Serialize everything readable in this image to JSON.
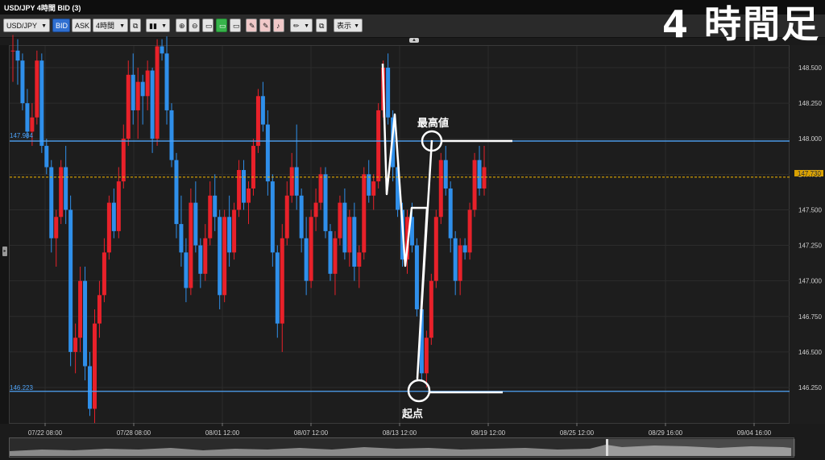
{
  "window": {
    "title": "USD/JPY 4時間 BID (3)"
  },
  "overlay_title": "4 時間足",
  "toolbar": {
    "symbol": "USD/JPY",
    "bid": "BID",
    "ask": "ASK",
    "timeframe": "4時間",
    "display": "表示"
  },
  "colors": {
    "up": "#e8212a",
    "down": "#2f8fea",
    "hline": "#4fa3f7",
    "current": "#f5b800",
    "annotation": "#ffffff"
  },
  "y_ticks": [
    "148.500",
    "148.250",
    "148.000",
    "147.750",
    "147.500",
    "147.250",
    "147.000",
    "146.750",
    "146.500",
    "146.250"
  ],
  "x_ticks": [
    "07/22 08:00",
    "07/28 08:00",
    "08/01 12:00",
    "08/07 12:00",
    "08/13 12:00",
    "08/19 12:00",
    "08/25 12:00",
    "08/29 16:00",
    "09/04 16:00"
  ],
  "lines": {
    "high_value": "147.984",
    "low_value": "146.223",
    "current_right": "147.760",
    "current_badge": "147.730"
  },
  "annotations": {
    "high": "最高値",
    "start": "起点"
  },
  "chart_data": {
    "type": "candlestick",
    "symbol": "USD/JPY",
    "timeframe": "4時間",
    "price": "BID",
    "ylim": [
      146.0,
      148.7
    ],
    "horizontal_lines": [
      147.984,
      146.223
    ],
    "current_price": 147.73,
    "annotated_points": [
      {
        "label": "最高値",
        "value": 147.984
      },
      {
        "label": "起点",
        "value": 146.223
      }
    ],
    "candles": [
      [
        148.62,
        148.73,
        148.4,
        148.62
      ],
      [
        148.62,
        148.7,
        148.38,
        148.55
      ],
      [
        148.55,
        148.6,
        148.2,
        148.25
      ],
      [
        148.25,
        148.35,
        148.0,
        148.05
      ],
      [
        148.05,
        148.25,
        147.95,
        148.15
      ],
      [
        148.15,
        148.62,
        148.1,
        148.55
      ],
      [
        148.55,
        148.6,
        147.9,
        147.95
      ],
      [
        147.95,
        148.0,
        147.75,
        147.8
      ],
      [
        147.8,
        147.85,
        147.2,
        147.3
      ],
      [
        147.3,
        147.5,
        147.1,
        147.45
      ],
      [
        147.45,
        147.85,
        147.4,
        147.8
      ],
      [
        147.8,
        147.95,
        147.4,
        147.5
      ],
      [
        147.5,
        147.6,
        146.4,
        146.5
      ],
      [
        146.5,
        146.7,
        146.35,
        146.6
      ],
      [
        146.6,
        147.1,
        146.5,
        147.0
      ],
      [
        147.0,
        147.1,
        146.3,
        146.4
      ],
      [
        146.4,
        146.5,
        146.05,
        146.1
      ],
      [
        146.1,
        146.8,
        146.0,
        146.7
      ],
      [
        146.7,
        147.0,
        146.6,
        146.9
      ],
      [
        146.9,
        147.3,
        146.85,
        147.2
      ],
      [
        147.2,
        147.6,
        147.15,
        147.55
      ],
      [
        147.55,
        147.65,
        147.3,
        147.35
      ],
      [
        147.35,
        147.8,
        147.3,
        147.7
      ],
      [
        147.7,
        148.1,
        147.65,
        148.0
      ],
      [
        148.0,
        148.55,
        147.95,
        148.45
      ],
      [
        148.45,
        148.6,
        148.1,
        148.2
      ],
      [
        148.2,
        148.5,
        148.0,
        148.4
      ],
      [
        148.4,
        148.45,
        148.1,
        148.3
      ],
      [
        148.3,
        148.55,
        148.2,
        148.48
      ],
      [
        148.48,
        148.5,
        147.9,
        148.0
      ],
      [
        148.0,
        148.7,
        147.95,
        148.65
      ],
      [
        148.65,
        148.7,
        148.55,
        148.6
      ],
      [
        148.6,
        148.72,
        148.1,
        148.2
      ],
      [
        148.2,
        148.25,
        147.8,
        147.85
      ],
      [
        147.85,
        147.9,
        147.3,
        147.4
      ],
      [
        147.4,
        147.6,
        147.1,
        147.2
      ],
      [
        147.2,
        147.3,
        146.85,
        146.95
      ],
      [
        146.95,
        147.65,
        146.9,
        147.55
      ],
      [
        147.55,
        147.7,
        147.2,
        147.25
      ],
      [
        147.25,
        147.3,
        146.95,
        147.05
      ],
      [
        147.05,
        147.4,
        147.0,
        147.3
      ],
      [
        147.3,
        147.7,
        147.25,
        147.6
      ],
      [
        147.6,
        147.75,
        147.35,
        147.45
      ],
      [
        147.45,
        147.5,
        146.8,
        146.9
      ],
      [
        146.9,
        147.5,
        146.85,
        147.45
      ],
      [
        147.45,
        147.6,
        147.1,
        147.2
      ],
      [
        147.2,
        147.55,
        147.15,
        147.5
      ],
      [
        147.5,
        147.85,
        147.45,
        147.78
      ],
      [
        147.78,
        147.85,
        147.5,
        147.55
      ],
      [
        147.55,
        147.7,
        147.4,
        147.65
      ],
      [
        147.65,
        148.0,
        147.6,
        147.95
      ],
      [
        147.95,
        148.35,
        147.9,
        148.3
      ],
      [
        148.3,
        148.4,
        148.05,
        148.1
      ],
      [
        148.1,
        148.2,
        147.6,
        147.7
      ],
      [
        147.7,
        147.75,
        147.1,
        147.2
      ],
      [
        147.2,
        147.25,
        146.6,
        146.7
      ],
      [
        146.7,
        147.4,
        146.5,
        147.3
      ],
      [
        147.3,
        147.7,
        147.25,
        147.6
      ],
      [
        147.6,
        147.9,
        147.55,
        147.8
      ],
      [
        147.8,
        148.1,
        147.5,
        147.6
      ],
      [
        147.6,
        147.65,
        147.2,
        147.3
      ],
      [
        147.3,
        147.45,
        146.9,
        147.0
      ],
      [
        147.0,
        147.5,
        146.95,
        147.45
      ],
      [
        147.45,
        147.65,
        147.35,
        147.55
      ],
      [
        147.55,
        147.8,
        147.5,
        147.75
      ],
      [
        147.75,
        147.8,
        147.3,
        147.35
      ],
      [
        147.35,
        147.4,
        147.0,
        147.05
      ],
      [
        147.05,
        147.35,
        146.9,
        147.3
      ],
      [
        147.3,
        147.6,
        147.25,
        147.55
      ],
      [
        147.55,
        147.65,
        147.15,
        147.2
      ],
      [
        147.2,
        147.5,
        147.1,
        147.45
      ],
      [
        147.45,
        147.55,
        147.0,
        147.1
      ],
      [
        147.1,
        147.25,
        146.95,
        147.2
      ],
      [
        147.2,
        147.8,
        147.15,
        147.75
      ],
      [
        147.75,
        147.85,
        147.55,
        147.6
      ],
      [
        147.6,
        147.75,
        147.5,
        147.7
      ],
      [
        147.7,
        148.25,
        147.65,
        148.2
      ],
      [
        148.2,
        148.55,
        148.15,
        148.5
      ],
      [
        148.5,
        148.6,
        148.1,
        148.15
      ],
      [
        148.15,
        148.2,
        147.7,
        147.8
      ],
      [
        147.8,
        147.85,
        147.45,
        147.5
      ],
      [
        147.5,
        147.55,
        147.1,
        147.15
      ],
      [
        147.15,
        147.5,
        147.05,
        147.45
      ],
      [
        147.45,
        147.55,
        147.2,
        147.25
      ],
      [
        147.25,
        147.3,
        146.75,
        146.8
      ],
      [
        146.8,
        146.85,
        146.3,
        146.35
      ],
      [
        146.35,
        146.65,
        146.25,
        146.6
      ],
      [
        146.6,
        147.05,
        146.55,
        147.0
      ],
      [
        147.0,
        147.5,
        146.95,
        147.45
      ],
      [
        147.45,
        147.9,
        147.4,
        147.85
      ],
      [
        147.85,
        147.95,
        147.6,
        147.65
      ],
      [
        147.65,
        147.7,
        147.2,
        147.3
      ],
      [
        147.3,
        147.35,
        146.9,
        147.0
      ],
      [
        147.0,
        147.3,
        146.9,
        147.25
      ],
      [
        147.25,
        147.3,
        147.15,
        147.2
      ],
      [
        147.2,
        147.55,
        147.15,
        147.5
      ],
      [
        147.5,
        147.9,
        147.45,
        147.85
      ],
      [
        147.85,
        147.95,
        147.6,
        147.65
      ],
      [
        147.65,
        147.95,
        147.6,
        147.8
      ]
    ]
  }
}
